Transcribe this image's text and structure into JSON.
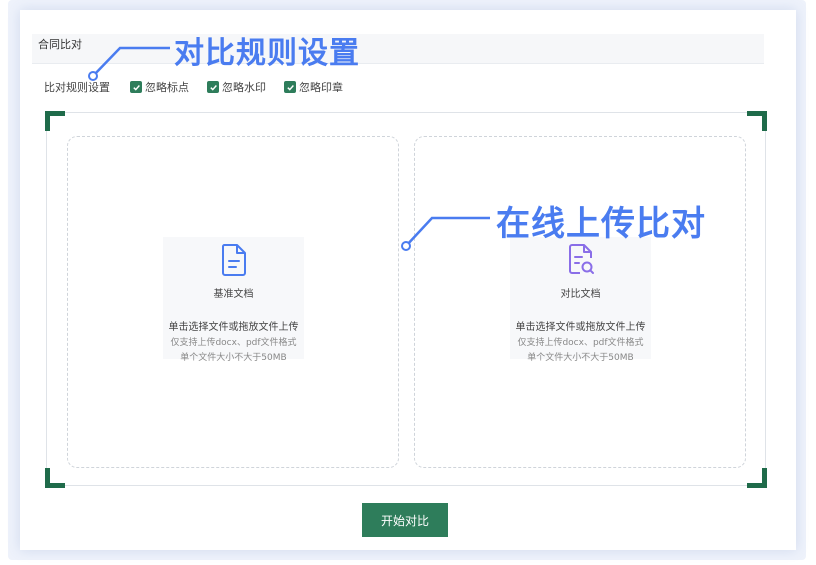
{
  "colors": {
    "accent": "#2e7d5b",
    "callout": "#4a7cf0",
    "corner": "#1f6b4a"
  },
  "panel": {
    "title": "合同比对"
  },
  "rules": {
    "label": "比对规则设置",
    "options": [
      {
        "label": "忽略标点",
        "checked": true
      },
      {
        "label": "忽略水印",
        "checked": true
      },
      {
        "label": "忽略印章",
        "checked": true
      }
    ]
  },
  "upload": {
    "base": {
      "icon": "document-icon",
      "label": "基准文档"
    },
    "compare": {
      "icon": "document-search-icon",
      "label": "对比文档"
    },
    "hint": "单击选择文件或拖放文件上传",
    "format_note": "仅支持上传docx、pdf文件格式",
    "size_note": "单个文件大小不大于50MB"
  },
  "callouts": {
    "rules": "对比规则设置",
    "upload": "在线上传比对"
  },
  "actions": {
    "start_label": "开始对比"
  }
}
